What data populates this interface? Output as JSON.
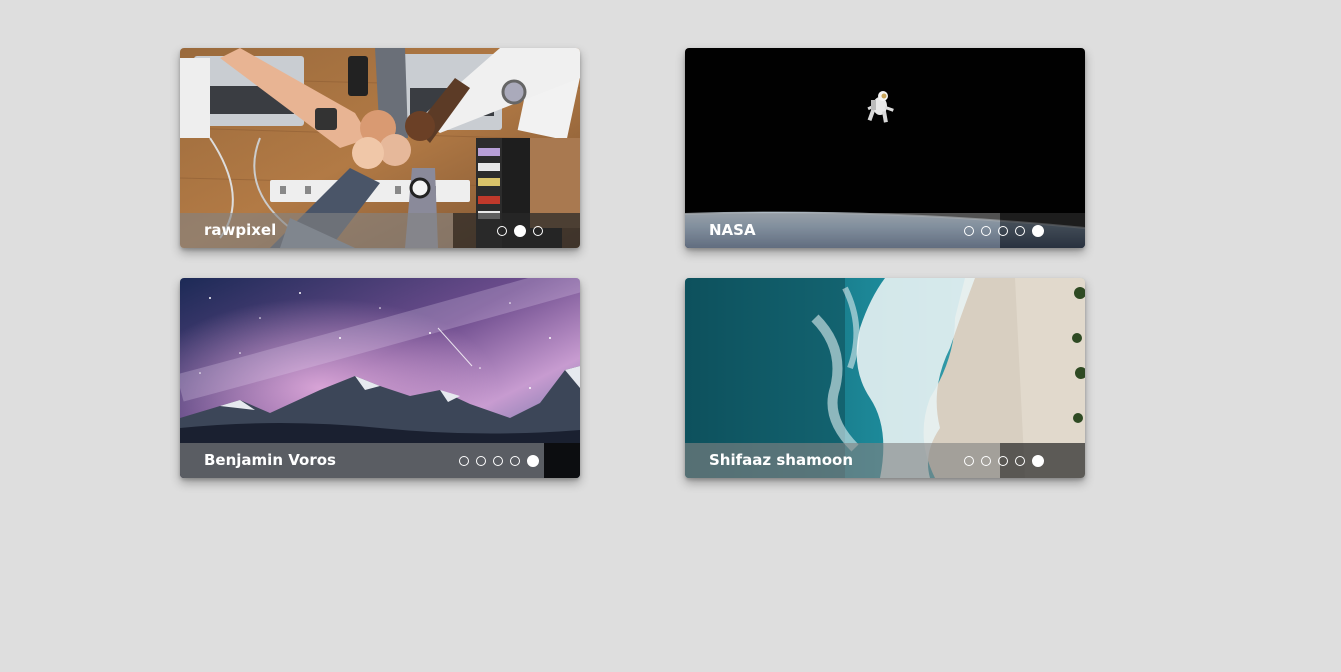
{
  "cards": [
    {
      "caption": "rawpixel",
      "slide_count": 3,
      "active_slide": 2
    },
    {
      "caption": "NASA",
      "slide_count": 5,
      "active_slide": 5
    },
    {
      "caption": "Benjamin Voros",
      "slide_count": 5,
      "active_slide": 5
    },
    {
      "caption": "Shifaaz shamoon",
      "slide_count": 5,
      "active_slide": 5
    }
  ],
  "colors": {
    "page_background": "#dedede",
    "caption_text": "#ffffff",
    "dot_color": "#ffffff"
  }
}
